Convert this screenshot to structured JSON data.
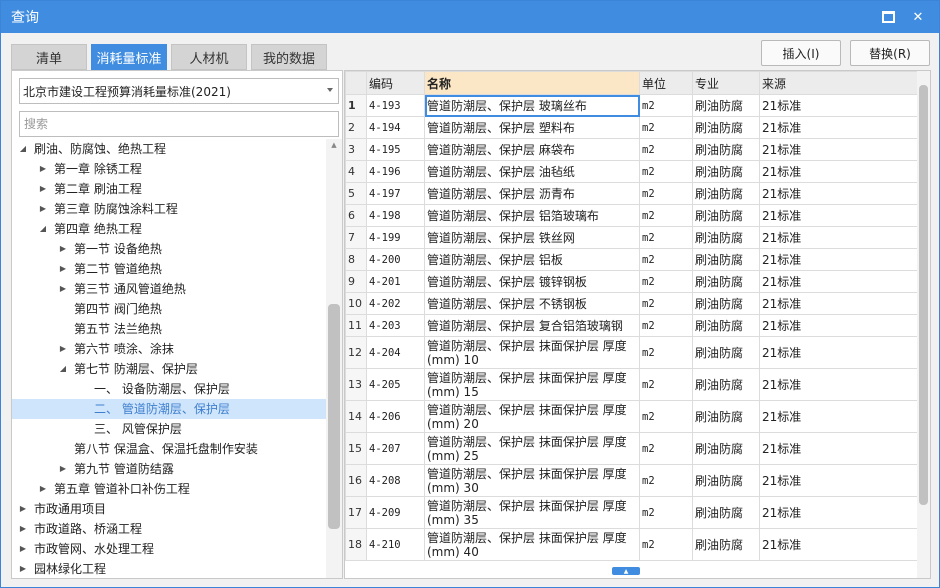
{
  "window": {
    "title": "查询"
  },
  "tabs": [
    {
      "label": "清单",
      "active": false
    },
    {
      "label": "消耗量标准",
      "active": true
    },
    {
      "label": "人材机",
      "active": false
    },
    {
      "label": "我的数据",
      "active": false
    }
  ],
  "buttons": {
    "insert": "插入(I)",
    "replace": "替换(R)"
  },
  "left": {
    "standard": "北京市建设工程预算消耗量标准(2021)",
    "search_placeholder": "搜索",
    "tree": [
      {
        "label": "刷油、防腐蚀、绝热工程",
        "level": 0,
        "state": "expanded"
      },
      {
        "label": "第一章 除锈工程",
        "level": 1,
        "state": "collapsed"
      },
      {
        "label": "第二章 刷油工程",
        "level": 1,
        "state": "collapsed"
      },
      {
        "label": "第三章 防腐蚀涂料工程",
        "level": 1,
        "state": "collapsed"
      },
      {
        "label": "第四章 绝热工程",
        "level": 1,
        "state": "expanded"
      },
      {
        "label": "第一节 设备绝热",
        "level": 2,
        "state": "collapsed"
      },
      {
        "label": "第二节 管道绝热",
        "level": 2,
        "state": "collapsed"
      },
      {
        "label": "第三节 通风管道绝热",
        "level": 2,
        "state": "collapsed"
      },
      {
        "label": "第四节 阀门绝热",
        "level": 2,
        "state": "leaf"
      },
      {
        "label": "第五节 法兰绝热",
        "level": 2,
        "state": "leaf"
      },
      {
        "label": "第六节 喷涂、涂抹",
        "level": 2,
        "state": "collapsed"
      },
      {
        "label": "第七节 防潮层、保护层",
        "level": 2,
        "state": "expanded"
      },
      {
        "label": "一、 设备防潮层、保护层",
        "level": 3,
        "state": "leaf"
      },
      {
        "label": "二、 管道防潮层、保护层",
        "level": 3,
        "state": "leaf",
        "selected": true
      },
      {
        "label": "三、 风管保护层",
        "level": 3,
        "state": "leaf"
      },
      {
        "label": "第八节 保温盒、保温托盘制作安装",
        "level": 2,
        "state": "leaf"
      },
      {
        "label": "第九节 管道防结露",
        "level": 2,
        "state": "collapsed"
      },
      {
        "label": "第五章 管道补口补伤工程",
        "level": 1,
        "state": "collapsed"
      },
      {
        "label": "市政通用项目",
        "level": 0,
        "state": "collapsed"
      },
      {
        "label": "市政道路、桥涵工程",
        "level": 0,
        "state": "collapsed"
      },
      {
        "label": "市政管网、水处理工程",
        "level": 0,
        "state": "collapsed"
      },
      {
        "label": "园林绿化工程",
        "level": 0,
        "state": "collapsed"
      }
    ]
  },
  "grid": {
    "columns": [
      "",
      "编码",
      "名称",
      "单位",
      "专业",
      "来源"
    ],
    "rows": [
      {
        "no": "1",
        "code": "4-193",
        "name": "管道防潮层、保护层 玻璃丝布",
        "unit": "m2",
        "major": "刷油防腐",
        "source": "21标准"
      },
      {
        "no": "2",
        "code": "4-194",
        "name": "管道防潮层、保护层 塑料布",
        "unit": "m2",
        "major": "刷油防腐",
        "source": "21标准"
      },
      {
        "no": "3",
        "code": "4-195",
        "name": "管道防潮层、保护层 麻袋布",
        "unit": "m2",
        "major": "刷油防腐",
        "source": "21标准"
      },
      {
        "no": "4",
        "code": "4-196",
        "name": "管道防潮层、保护层 油毡纸",
        "unit": "m2",
        "major": "刷油防腐",
        "source": "21标准"
      },
      {
        "no": "5",
        "code": "4-197",
        "name": "管道防潮层、保护层 沥青布",
        "unit": "m2",
        "major": "刷油防腐",
        "source": "21标准"
      },
      {
        "no": "6",
        "code": "4-198",
        "name": "管道防潮层、保护层 铝箔玻璃布",
        "unit": "m2",
        "major": "刷油防腐",
        "source": "21标准"
      },
      {
        "no": "7",
        "code": "4-199",
        "name": "管道防潮层、保护层 铁丝网",
        "unit": "m2",
        "major": "刷油防腐",
        "source": "21标准"
      },
      {
        "no": "8",
        "code": "4-200",
        "name": "管道防潮层、保护层 铝板",
        "unit": "m2",
        "major": "刷油防腐",
        "source": "21标准"
      },
      {
        "no": "9",
        "code": "4-201",
        "name": "管道防潮层、保护层 镀锌钢板",
        "unit": "m2",
        "major": "刷油防腐",
        "source": "21标准"
      },
      {
        "no": "10",
        "code": "4-202",
        "name": "管道防潮层、保护层 不锈钢板",
        "unit": "m2",
        "major": "刷油防腐",
        "source": "21标准"
      },
      {
        "no": "11",
        "code": "4-203",
        "name": "管道防潮层、保护层 复合铝箔玻璃钢",
        "unit": "m2",
        "major": "刷油防腐",
        "source": "21标准"
      },
      {
        "no": "12",
        "code": "4-204",
        "name": "管道防潮层、保护层 抹面保护层 厚度(mm) 10",
        "unit": "m2",
        "major": "刷油防腐",
        "source": "21标准"
      },
      {
        "no": "13",
        "code": "4-205",
        "name": "管道防潮层、保护层 抹面保护层 厚度(mm) 15",
        "unit": "m2",
        "major": "刷油防腐",
        "source": "21标准"
      },
      {
        "no": "14",
        "code": "4-206",
        "name": "管道防潮层、保护层 抹面保护层 厚度(mm) 20",
        "unit": "m2",
        "major": "刷油防腐",
        "source": "21标准"
      },
      {
        "no": "15",
        "code": "4-207",
        "name": "管道防潮层、保护层 抹面保护层 厚度(mm) 25",
        "unit": "m2",
        "major": "刷油防腐",
        "source": "21标准"
      },
      {
        "no": "16",
        "code": "4-208",
        "name": "管道防潮层、保护层 抹面保护层 厚度(mm) 30",
        "unit": "m2",
        "major": "刷油防腐",
        "source": "21标准"
      },
      {
        "no": "17",
        "code": "4-209",
        "name": "管道防潮层、保护层 抹面保护层 厚度(mm) 35",
        "unit": "m2",
        "major": "刷油防腐",
        "source": "21标准"
      },
      {
        "no": "18",
        "code": "4-210",
        "name": "管道防潮层、保护层 抹面保护层 厚度(mm) 40",
        "unit": "m2",
        "major": "刷油防腐",
        "source": "21标准"
      }
    ]
  },
  "icons": {
    "maximize": "maximize-icon",
    "close": "close-icon",
    "dropdown": "chevron-down-icon",
    "expanded": "tree-expanded-icon",
    "collapsed": "tree-collapsed-icon"
  },
  "colors": {
    "accent": "#3f8ce0",
    "selected_row": "#cfe5fb",
    "header_highlight": "#fbe6c5"
  }
}
